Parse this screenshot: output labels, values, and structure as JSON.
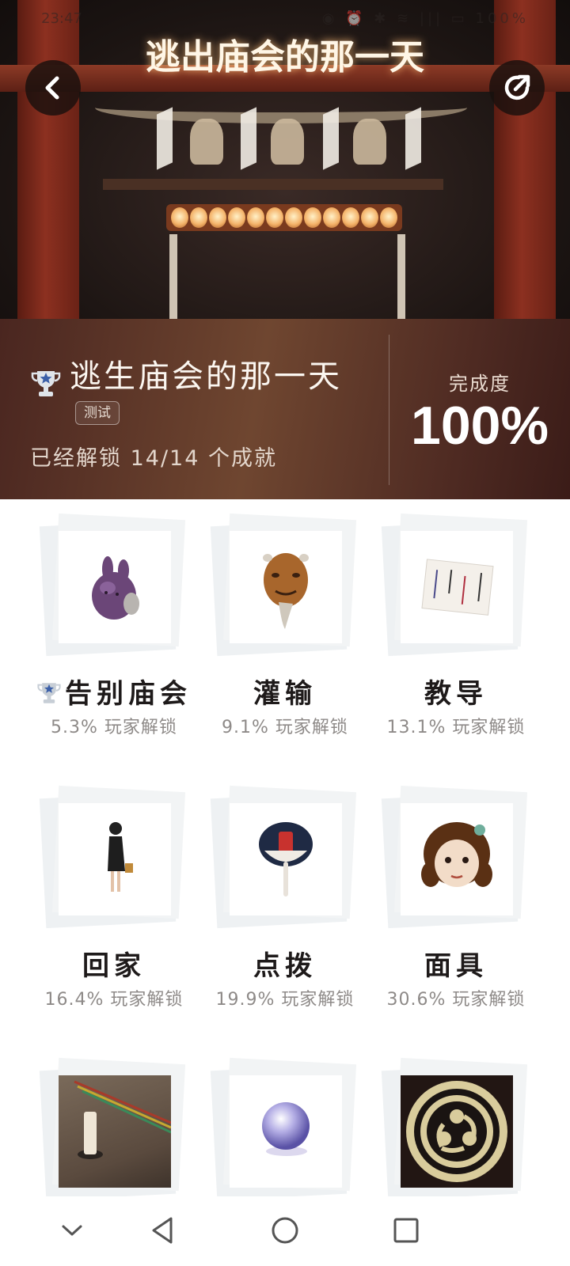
{
  "status_bar": {
    "time": "23:47",
    "icons": "◉ ⏰ ✱ ≋ ||| ▭ 100%"
  },
  "banner": {
    "title": "逃出庙会的那一天"
  },
  "game": {
    "title": "逃生庙会的那一天",
    "tag": "测试",
    "unlock_text": "已经解锁 14/14 个成就",
    "completion_label": "完成度",
    "completion_value": "100%"
  },
  "achievements": [
    {
      "name": "告别庙会",
      "rate": "5.3% 玩家解锁",
      "icon": "purple-rabbit-plush",
      "trophy": true
    },
    {
      "name": "灌输",
      "rate": "9.1% 玩家解锁",
      "icon": "old-man-mask"
    },
    {
      "name": "教导",
      "rate": "13.1% 玩家解锁",
      "icon": "paper-note"
    },
    {
      "name": "回家",
      "rate": "16.4% 玩家解锁",
      "icon": "standing-girl"
    },
    {
      "name": "点拨",
      "rate": "19.9% 玩家解锁",
      "icon": "uchiwa-fan"
    },
    {
      "name": "面具",
      "rate": "30.6% 玩家解锁",
      "icon": "doll-mask"
    },
    {
      "name": "",
      "rate": "",
      "icon": "candle-incense"
    },
    {
      "name": "",
      "rate": "",
      "icon": "glass-orb"
    },
    {
      "name": "",
      "rate": "",
      "icon": "mitsudomoe-crest"
    }
  ],
  "nav": {
    "back": "◁",
    "home": "○",
    "recent": "□",
    "collapse": "⌄"
  }
}
